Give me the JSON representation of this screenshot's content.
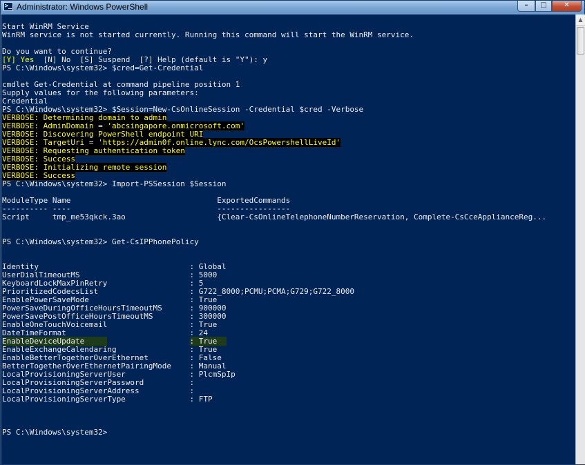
{
  "window": {
    "title": "Administrator: Windows PowerShell",
    "controls": {
      "minimize": "–",
      "maximize": "□",
      "close": "✕"
    },
    "icon": "powershell-icon",
    "icon_glyph": ">_"
  },
  "colors": {
    "console_bg": "#012456",
    "console_fg": "#eeedf0",
    "verbose_fg": "#ffff00",
    "verbose_bg": "#000000",
    "highlight_bg": "#1f3c1a"
  },
  "console": {
    "lines": [
      {
        "segments": [
          {
            "text": "Start WinRM Service"
          }
        ]
      },
      {
        "segments": [
          {
            "text": "WinRM service is not started currently. Running this command will start the WinRM service."
          }
        ]
      },
      {
        "segments": [
          {
            "text": ""
          }
        ]
      },
      {
        "segments": [
          {
            "text": "Do you want to continue?"
          }
        ]
      },
      {
        "segments": [
          {
            "text": "[Y] Yes",
            "style": "prompt-y"
          },
          {
            "text": "  [N] No  [S] Suspend  [?] Help (default is \"Y\"): y"
          }
        ]
      },
      {
        "segments": [
          {
            "text": "PS C:\\Windows\\system32> $cred=Get-Credential"
          }
        ]
      },
      {
        "segments": [
          {
            "text": ""
          }
        ]
      },
      {
        "segments": [
          {
            "text": "cmdlet Get-Credential at command pipeline position 1"
          }
        ]
      },
      {
        "segments": [
          {
            "text": "Supply values for the following parameters:"
          }
        ]
      },
      {
        "segments": [
          {
            "text": "Credential"
          }
        ]
      },
      {
        "segments": [
          {
            "text": "PS C:\\Windows\\system32> $Session=New-CsOnlineSession -Credential $cred -Verbose"
          }
        ]
      },
      {
        "segments": [
          {
            "text": "VERBOSE: Determining domain to admin",
            "style": "verbose"
          }
        ]
      },
      {
        "segments": [
          {
            "text": "VERBOSE: AdminDomain = 'abcsingapore.onmicrosoft.com'",
            "style": "verbose"
          }
        ]
      },
      {
        "segments": [
          {
            "text": "VERBOSE: Discovering PowerShell endpoint URI",
            "style": "verbose"
          }
        ]
      },
      {
        "segments": [
          {
            "text": "VERBOSE: TargetUri = 'https://admin0f.online.lync.com/OcsPowershellLiveId'",
            "style": "verbose"
          }
        ]
      },
      {
        "segments": [
          {
            "text": "VERBOSE: Requesting authentication token",
            "style": "verbose"
          }
        ]
      },
      {
        "segments": [
          {
            "text": "VERBOSE: Success",
            "style": "verbose"
          }
        ]
      },
      {
        "segments": [
          {
            "text": "VERBOSE: Initializing remote session",
            "style": "verbose"
          }
        ]
      },
      {
        "segments": [
          {
            "text": "VERBOSE: Success",
            "style": "verbose"
          }
        ]
      },
      {
        "segments": [
          {
            "text": "PS C:\\Windows\\system32> Import-PSSession $Session"
          }
        ]
      },
      {
        "segments": [
          {
            "text": ""
          }
        ]
      },
      {
        "segments": [
          {
            "text": "ModuleType Name                                ExportedCommands"
          }
        ]
      },
      {
        "segments": [
          {
            "text": "---------- ----                                ----------------"
          }
        ]
      },
      {
        "segments": [
          {
            "text": "Script     tmp_me53qkck.3ao                    {Clear-CsOnlineTelephoneNumberReservation, Complete-CsCceApplianceReg..."
          }
        ]
      },
      {
        "segments": [
          {
            "text": ""
          }
        ]
      },
      {
        "segments": [
          {
            "text": ""
          }
        ]
      },
      {
        "segments": [
          {
            "text": "PS C:\\Windows\\system32> Get-CsIPPhonePolicy"
          }
        ]
      },
      {
        "segments": [
          {
            "text": ""
          }
        ]
      },
      {
        "segments": [
          {
            "text": ""
          }
        ]
      },
      {
        "segments": [
          {
            "text": "Identity                                 : Global"
          }
        ]
      },
      {
        "segments": [
          {
            "text": "UserDialTimeoutMS                        : 5000"
          }
        ]
      },
      {
        "segments": [
          {
            "text": "KeyboardLockMaxPinRetry                  : 5"
          }
        ]
      },
      {
        "segments": [
          {
            "text": "PrioritizedCodecsList                    : G722_8000;PCMU;PCMA;G729;G722_8000"
          }
        ]
      },
      {
        "segments": [
          {
            "text": "EnablePowerSaveMode                      : True"
          }
        ]
      },
      {
        "segments": [
          {
            "text": "PowerSaveDuringOfficeHoursTimeoutMS      : 900000"
          }
        ]
      },
      {
        "segments": [
          {
            "text": "PowerSavePostOfficeHoursTimeoutMS        : 300000"
          }
        ]
      },
      {
        "segments": [
          {
            "text": "EnableOneTouchVoicemail                  : True"
          }
        ]
      },
      {
        "segments": [
          {
            "text": "DateTimeFormat                           : 24"
          }
        ]
      },
      {
        "segments": [
          {
            "text": "EnableDeviceUpdate     ",
            "style": "hl"
          },
          {
            "text": "                  "
          },
          {
            "text": ": True  ",
            "style": "hl"
          }
        ]
      },
      {
        "segments": [
          {
            "text": "EnableExchangeCalendaring                : True"
          }
        ]
      },
      {
        "segments": [
          {
            "text": "EnableBetterTogetherOverEthernet         : False"
          }
        ]
      },
      {
        "segments": [
          {
            "text": "BetterTogetherOverEthernetPairingMode    : Manual"
          }
        ]
      },
      {
        "segments": [
          {
            "text": "LocalProvisioningServerUser              : PlcmSpIp"
          }
        ]
      },
      {
        "segments": [
          {
            "text": "LocalProvisioningServerPassword          :"
          }
        ]
      },
      {
        "segments": [
          {
            "text": "LocalProvisioningServerAddress           :"
          }
        ]
      },
      {
        "segments": [
          {
            "text": "LocalProvisioningServerType              : FTP"
          }
        ]
      },
      {
        "segments": [
          {
            "text": ""
          }
        ]
      },
      {
        "segments": [
          {
            "text": ""
          }
        ]
      },
      {
        "segments": [
          {
            "text": ""
          }
        ]
      },
      {
        "segments": [
          {
            "text": "PS C:\\Windows\\system32>"
          }
        ]
      }
    ]
  },
  "scrollbar": {
    "up_arrow": "▲"
  }
}
